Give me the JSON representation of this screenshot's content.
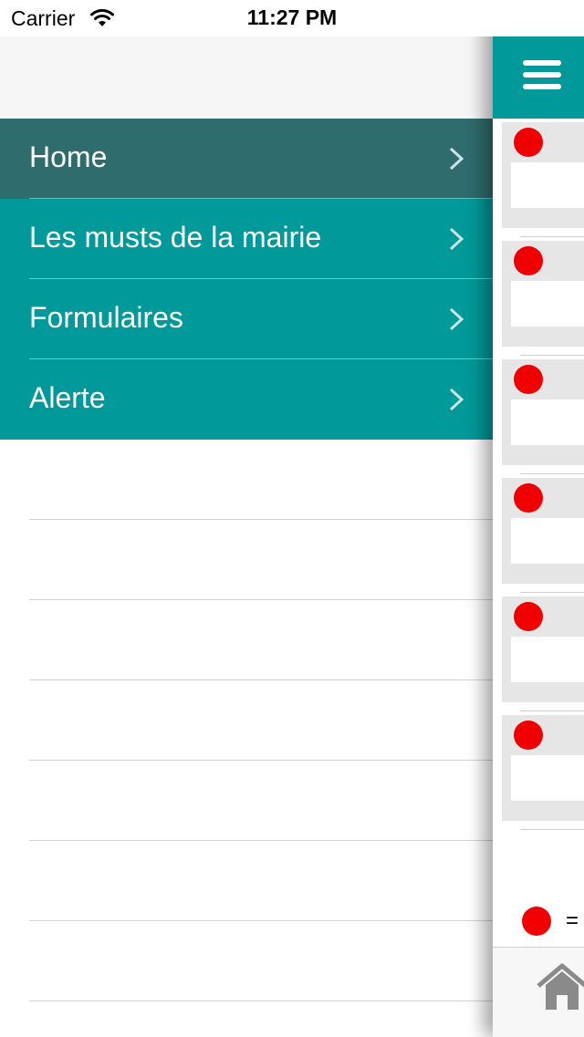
{
  "status_bar": {
    "carrier": "Carrier",
    "time": "11:27 PM"
  },
  "menu": {
    "items": [
      {
        "label": "Home",
        "selected": true
      },
      {
        "label": "Les musts de la mairie",
        "selected": false
      },
      {
        "label": "Formulaires",
        "selected": false
      },
      {
        "label": "Alerte",
        "selected": false
      }
    ]
  },
  "content": {
    "legend_text": "=",
    "alert_color": "#f00000"
  },
  "colors": {
    "accent": "#019999",
    "selected": "#2f6c6d"
  }
}
